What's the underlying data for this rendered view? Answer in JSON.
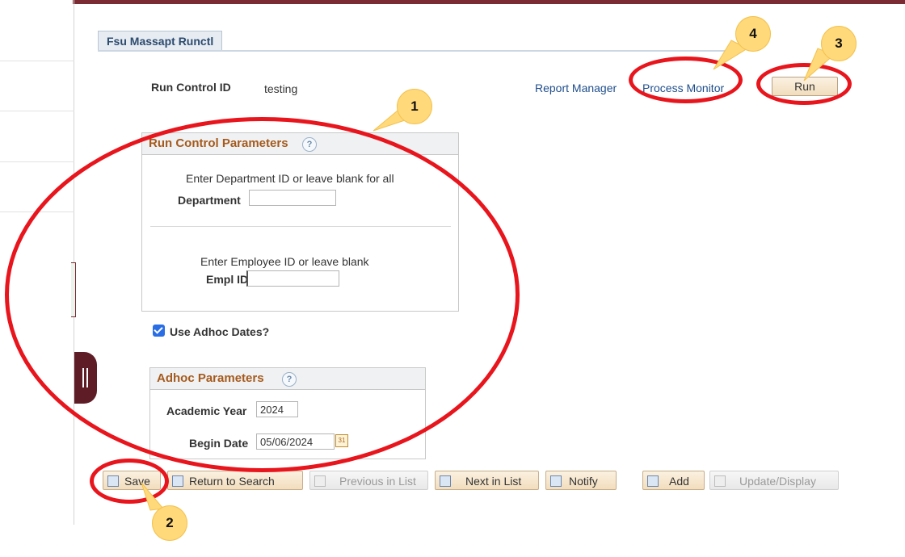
{
  "page_tab": "Fsu Massapt Runctl",
  "run_control": {
    "label": "Run Control ID",
    "value": "testing"
  },
  "links": {
    "report_manager": "Report Manager",
    "process_monitor": "Process Monitor"
  },
  "run_button": "Run",
  "run_params": {
    "title": "Run Control Parameters",
    "help_glyph": "?",
    "dept_hint": "Enter Department ID or leave blank for all",
    "dept_label": "Department",
    "dept_value": "",
    "empl_hint": "Enter Employee ID or leave blank",
    "empl_label": "Empl ID",
    "empl_value": ""
  },
  "adhoc_checkbox": {
    "label": "Use Adhoc Dates?",
    "checked": true
  },
  "adhoc_params": {
    "title": "Adhoc Parameters",
    "help_glyph": "?",
    "year_label": "Academic Year",
    "year_value": "2024",
    "begin_label": "Begin Date",
    "begin_value": "05/06/2024",
    "calendar_glyph": "31"
  },
  "toolbar": {
    "save": "Save",
    "return_to_search": "Return to Search",
    "previous_in_list": "Previous in List",
    "next_in_list": "Next in List",
    "notify": "Notify",
    "add": "Add",
    "update_display": "Update/Display"
  },
  "callouts": {
    "c1": "1",
    "c2": "2",
    "c3": "3",
    "c4": "4"
  },
  "colors": {
    "brand_bar": "#7a2b34",
    "link": "#1f4e8c",
    "group_title": "#a65a1c",
    "highlight_ring": "#e8151d",
    "callout_fill": "#ffd97a"
  }
}
